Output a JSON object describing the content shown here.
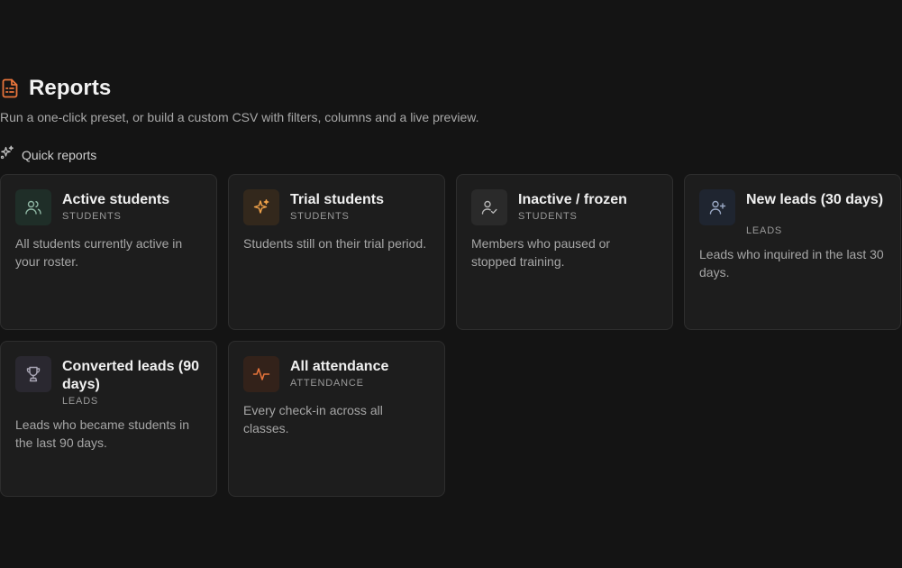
{
  "header": {
    "title": "Reports",
    "subtitle": "Run a one-click preset, or build a custom CSV with filters, columns and a live preview.",
    "icon": "file-report-icon",
    "accent": "#e8743b"
  },
  "quick_reports": {
    "label": "Quick reports",
    "icon": "sparkles-icon",
    "cards": [
      {
        "title": "Active students",
        "category": "STUDENTS",
        "description": "All students currently active in your roster.",
        "icon": "users-icon",
        "icon_bg": "#1f2e28",
        "icon_color": "#8fb7a4"
      },
      {
        "title": "Trial students",
        "category": "STUDENTS",
        "description": "Students still on their trial period.",
        "icon": "sparkle-icon",
        "icon_bg": "#33281c",
        "icon_color": "#f0a24a"
      },
      {
        "title": "Inactive / frozen",
        "category": "STUDENTS",
        "description": "Members who paused or stopped training.",
        "icon": "user-check-icon",
        "icon_bg": "#2a2a2a",
        "icon_color": "#b5b5b5"
      },
      {
        "title": "New leads (30 days)",
        "category": "LEADS",
        "description": "Leads who inquired in the last 30 days.",
        "icon": "user-plus-icon",
        "icon_bg": "#1f2530",
        "icon_color": "#9aa8c4"
      },
      {
        "title": "Converted leads (90 days)",
        "category": "LEADS",
        "description": "Leads who became students in the last 90 days.",
        "icon": "trophy-icon",
        "icon_bg": "#2a2830",
        "icon_color": "#a9a6b5"
      },
      {
        "title": "All attendance",
        "category": "ATTENDANCE",
        "description": "Every check-in across all classes.",
        "icon": "activity-icon",
        "icon_bg": "#33221a",
        "icon_color": "#e8743b"
      }
    ]
  }
}
